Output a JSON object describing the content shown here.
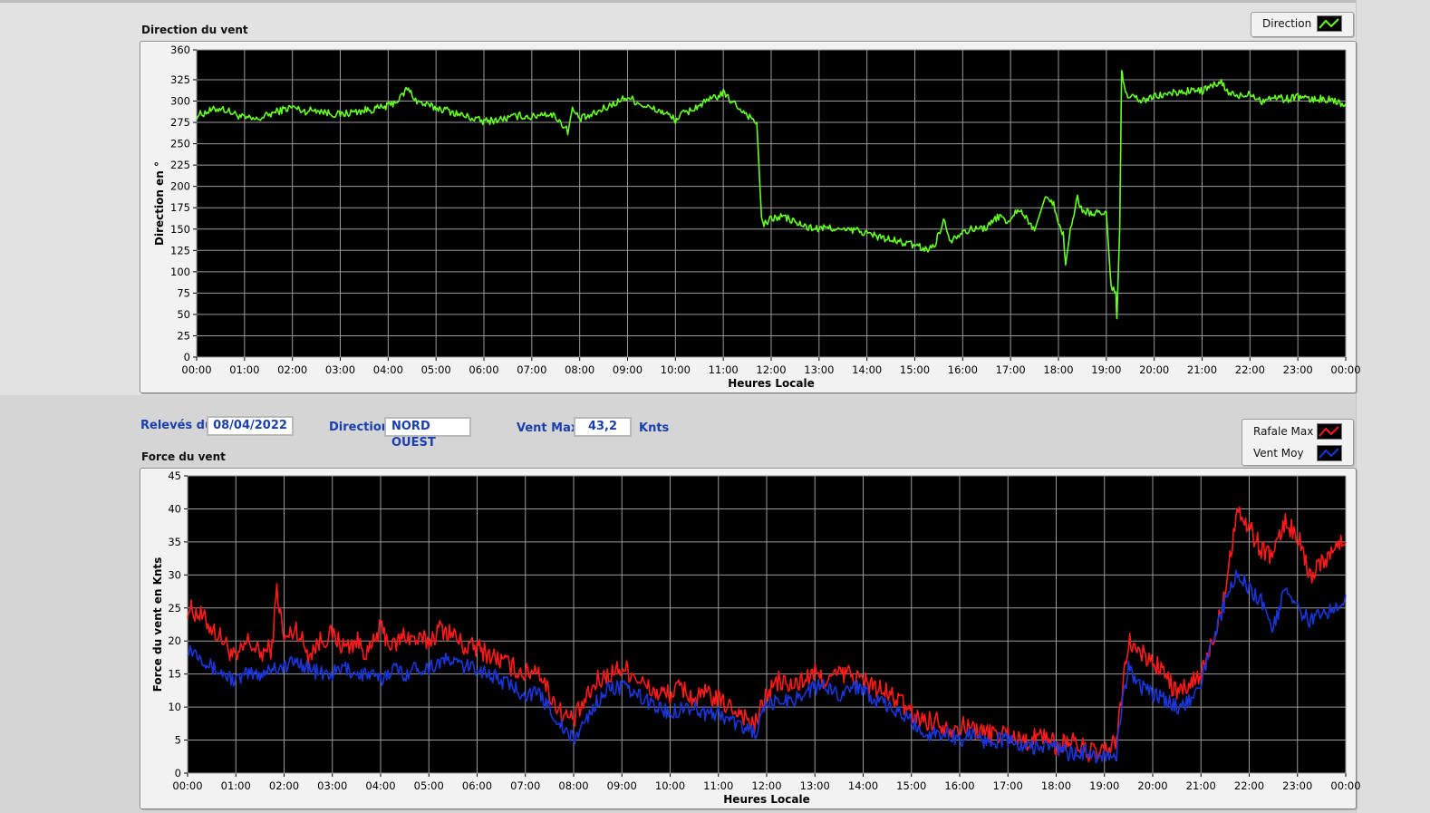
{
  "colors": {
    "direction": "#66ff22",
    "rafale": "#ff1a1a",
    "vent_moy": "#1a35d8",
    "plot_bg": "#000000",
    "grid": "#9a9a9a",
    "label_blue": "#1a3fae"
  },
  "direction_panel": {
    "title": "Direction du vent",
    "legend": {
      "label": "Direction"
    }
  },
  "info_row": {
    "releves_label": "Relevés du",
    "releves_value": "08/04/2022",
    "direction_label": "Direction",
    "direction_value": "NORD OUEST",
    "ventmax_label": "Vent Max",
    "ventmax_value": "43,2",
    "ventmax_unit": "Knts"
  },
  "force_panel": {
    "title": "Force du vent",
    "legend": {
      "rafale_label": "Rafale Max",
      "ventmoy_label": "Vent Moy"
    }
  },
  "chart_data": [
    {
      "type": "line",
      "title": "Direction du vent",
      "xlabel": "Heures Locale",
      "ylabel": "Direction en °",
      "ylim": [
        0,
        360
      ],
      "xlim": [
        0,
        24
      ],
      "y_ticks": [
        "360",
        "325",
        "300",
        "275",
        "250",
        "225",
        "200",
        "175",
        "150",
        "125",
        "100",
        "75",
        "50",
        "25",
        "0"
      ],
      "y_tick_values": [
        360,
        325,
        300,
        275,
        250,
        225,
        200,
        175,
        150,
        125,
        100,
        75,
        50,
        25,
        0
      ],
      "x_ticks": [
        "00:00",
        "01:00",
        "02:00",
        "03:00",
        "04:00",
        "05:00",
        "06:00",
        "07:00",
        "08:00",
        "09:00",
        "10:00",
        "11:00",
        "12:00",
        "13:00",
        "14:00",
        "15:00",
        "16:00",
        "17:00",
        "18:00",
        "19:00",
        "20:00",
        "21:00",
        "22:00",
        "23:00",
        "00:00"
      ],
      "grid": true,
      "legend": "top-right",
      "series": [
        {
          "name": "Direction",
          "x": [
            0,
            0.25,
            0.5,
            0.75,
            1.0,
            1.25,
            1.5,
            1.75,
            2.0,
            2.25,
            2.5,
            2.75,
            3.0,
            3.25,
            3.5,
            3.75,
            4.0,
            4.25,
            4.4,
            4.6,
            4.75,
            5.0,
            5.25,
            5.5,
            5.75,
            6.0,
            6.25,
            6.5,
            6.75,
            7.0,
            7.25,
            7.5,
            7.75,
            7.85,
            8.0,
            8.25,
            8.5,
            8.75,
            9.0,
            9.25,
            9.5,
            9.75,
            10.0,
            10.15,
            10.25,
            10.5,
            10.75,
            11.0,
            11.25,
            11.5,
            11.7,
            11.8,
            11.85,
            12.0,
            12.25,
            12.5,
            12.75,
            13.0,
            13.25,
            13.5,
            13.75,
            14.0,
            14.25,
            14.5,
            14.75,
            15.0,
            15.25,
            15.4,
            15.5,
            15.6,
            15.75,
            16.0,
            16.25,
            16.5,
            16.75,
            17.0,
            17.15,
            17.3,
            17.5,
            17.75,
            17.9,
            18.0,
            18.1,
            18.15,
            18.25,
            18.4,
            18.5,
            18.75,
            19.0,
            19.1,
            19.2,
            19.22,
            19.28,
            19.32,
            19.35,
            19.4,
            19.5,
            19.75,
            20.0,
            20.25,
            20.5,
            20.75,
            21.0,
            21.25,
            21.4,
            21.5,
            21.75,
            22.0,
            22.25,
            22.5,
            22.75,
            23.0,
            23.25,
            23.5,
            23.75,
            24.0
          ],
          "values": [
            283,
            288,
            292,
            286,
            280,
            278,
            284,
            289,
            293,
            288,
            290,
            286,
            284,
            287,
            289,
            291,
            294,
            303,
            315,
            300,
            296,
            292,
            289,
            284,
            280,
            276,
            278,
            280,
            283,
            281,
            286,
            282,
            265,
            290,
            279,
            283,
            291,
            298,
            305,
            297,
            291,
            287,
            278,
            285,
            287,
            295,
            302,
            309,
            296,
            284,
            275,
            160,
            155,
            162,
            165,
            158,
            152,
            150,
            152,
            148,
            149,
            145,
            141,
            137,
            134,
            131,
            126,
            130,
            145,
            160,
            137,
            148,
            150,
            152,
            165,
            158,
            175,
            165,
            148,
            192,
            178,
            155,
            145,
            108,
            150,
            186,
            172,
            168,
            170,
            80,
            78,
            45,
            150,
            338,
            320,
            308,
            305,
            300,
            305,
            308,
            310,
            312,
            312,
            318,
            322,
            312,
            305,
            310,
            300,
            305,
            302,
            306,
            301,
            303,
            300,
            297
          ]
        }
      ]
    },
    {
      "type": "line",
      "title": "Force du vent",
      "xlabel": "Heures Locale",
      "ylabel": "Force du vent en Knts",
      "ylim": [
        0,
        45
      ],
      "xlim": [
        0,
        24
      ],
      "y_ticks": [
        "45",
        "40",
        "35",
        "30",
        "25",
        "20",
        "15",
        "10",
        "5",
        "0"
      ],
      "y_tick_values": [
        45,
        40,
        35,
        30,
        25,
        20,
        15,
        10,
        5,
        0
      ],
      "x_ticks": [
        "00:00",
        "01:00",
        "02:00",
        "03:00",
        "04:00",
        "05:00",
        "06:00",
        "07:00",
        "08:00",
        "09:00",
        "10:00",
        "11:00",
        "12:00",
        "13:00",
        "14:00",
        "15:00",
        "16:00",
        "17:00",
        "18:00",
        "19:00",
        "20:00",
        "21:00",
        "22:00",
        "23:00",
        "00:00"
      ],
      "grid": true,
      "legend": "top-right",
      "series": [
        {
          "name": "Rafale Max",
          "x": [
            0,
            0.25,
            0.5,
            0.75,
            1.0,
            1.25,
            1.5,
            1.75,
            1.85,
            2.0,
            2.25,
            2.5,
            2.75,
            3.0,
            3.25,
            3.5,
            3.75,
            4.0,
            4.25,
            4.5,
            4.75,
            5.0,
            5.25,
            5.5,
            5.75,
            6.0,
            6.25,
            6.5,
            6.75,
            7.0,
            7.25,
            7.5,
            7.75,
            8.0,
            8.25,
            8.5,
            8.75,
            9.0,
            9.25,
            9.5,
            9.75,
            10.0,
            10.25,
            10.5,
            10.75,
            11.0,
            11.25,
            11.5,
            11.75,
            12.0,
            12.25,
            12.5,
            12.75,
            13.0,
            13.25,
            13.5,
            13.75,
            14.0,
            14.25,
            14.5,
            14.75,
            15.0,
            15.25,
            15.5,
            15.75,
            16.0,
            16.25,
            16.5,
            16.75,
            17.0,
            17.25,
            17.5,
            17.75,
            18.0,
            18.25,
            18.5,
            18.75,
            19.0,
            19.25,
            19.4,
            19.5,
            19.75,
            20.0,
            20.25,
            20.5,
            20.75,
            21.0,
            21.25,
            21.5,
            21.75,
            22.0,
            22.25,
            22.5,
            22.75,
            23.0,
            23.25,
            23.5,
            23.75,
            24.0
          ],
          "values": [
            25,
            24,
            22,
            20,
            17,
            20,
            18,
            19,
            28,
            20,
            22,
            18,
            20,
            21,
            19,
            20,
            18,
            22,
            19,
            21,
            20,
            20,
            22,
            21,
            19,
            19,
            18,
            17,
            16,
            15,
            16,
            12,
            9,
            8,
            11,
            14,
            15,
            16,
            15,
            13,
            12,
            12,
            13,
            11,
            12,
            11,
            10,
            9,
            7,
            12,
            14,
            13,
            14,
            15,
            14,
            15,
            15,
            14,
            13,
            12,
            11,
            9,
            8,
            8,
            7,
            7,
            7,
            6,
            6,
            6,
            5,
            5,
            6,
            4,
            5,
            4,
            3,
            3,
            5,
            14,
            20,
            18,
            17,
            15,
            12,
            13,
            15,
            20,
            28,
            40,
            37,
            34,
            33,
            38,
            36,
            30,
            32,
            34,
            35
          ]
        },
        {
          "name": "Vent Moy",
          "x": [
            0,
            0.25,
            0.5,
            0.75,
            1.0,
            1.25,
            1.5,
            1.75,
            2.0,
            2.25,
            2.5,
            2.75,
            3.0,
            3.25,
            3.5,
            3.75,
            4.0,
            4.25,
            4.5,
            4.75,
            5.0,
            5.25,
            5.5,
            5.75,
            6.0,
            6.25,
            6.5,
            6.75,
            7.0,
            7.25,
            7.5,
            7.75,
            8.0,
            8.25,
            8.5,
            8.75,
            9.0,
            9.25,
            9.5,
            9.75,
            10.0,
            10.25,
            10.5,
            10.75,
            11.0,
            11.25,
            11.5,
            11.75,
            12.0,
            12.25,
            12.5,
            12.75,
            13.0,
            13.25,
            13.5,
            13.75,
            14.0,
            14.25,
            14.5,
            14.75,
            15.0,
            15.25,
            15.5,
            15.75,
            16.0,
            16.25,
            16.5,
            16.75,
            17.0,
            17.25,
            17.5,
            17.75,
            18.0,
            18.25,
            18.5,
            18.75,
            19.0,
            19.25,
            19.4,
            19.5,
            19.75,
            20.0,
            20.25,
            20.5,
            20.75,
            21.0,
            21.25,
            21.5,
            21.75,
            22.0,
            22.25,
            22.5,
            22.75,
            23.0,
            23.25,
            23.5,
            23.75,
            24.0
          ],
          "values": [
            19,
            18,
            16,
            15,
            14,
            15,
            15,
            16,
            16,
            17,
            16,
            15,
            15,
            16,
            15,
            15,
            14,
            16,
            15,
            16,
            16,
            17,
            17,
            16,
            16,
            15,
            14,
            13,
            12,
            12,
            10,
            7,
            5,
            8,
            11,
            13,
            13,
            12,
            11,
            10,
            9,
            10,
            10,
            9,
            9,
            8,
            7,
            6,
            10,
            11,
            11,
            12,
            13,
            13,
            12,
            13,
            13,
            11,
            10,
            9,
            8,
            6,
            6,
            6,
            5,
            6,
            5,
            5,
            5,
            4,
            4,
            4,
            4,
            3,
            3,
            3,
            2,
            3,
            12,
            16,
            13,
            12,
            11,
            10,
            11,
            14,
            20,
            26,
            30,
            28,
            26,
            22,
            28,
            25,
            23,
            24,
            25,
            27
          ]
        }
      ]
    }
  ]
}
